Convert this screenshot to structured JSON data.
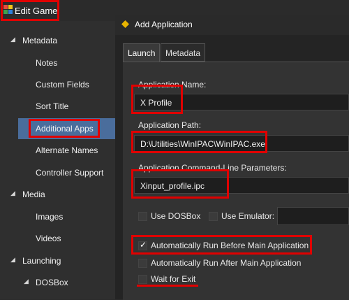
{
  "window": {
    "title": "Edit Game"
  },
  "sidebar": {
    "items": [
      {
        "label": "Metadata",
        "kind": "section"
      },
      {
        "label": "Notes",
        "kind": "child"
      },
      {
        "label": "Custom Fields",
        "kind": "child"
      },
      {
        "label": "Sort Title",
        "kind": "child"
      },
      {
        "label": "Additional Apps",
        "kind": "child",
        "selected": true
      },
      {
        "label": "Alternate Names",
        "kind": "child"
      },
      {
        "label": "Controller Support",
        "kind": "child"
      },
      {
        "label": "Media",
        "kind": "section"
      },
      {
        "label": "Images",
        "kind": "child"
      },
      {
        "label": "Videos",
        "kind": "child"
      },
      {
        "label": "Launching",
        "kind": "section"
      },
      {
        "label": "DOSBox",
        "kind": "subsection"
      }
    ],
    "expand_glyph": "◢",
    "selected_color": "#4a6d9c"
  },
  "dialog": {
    "title": "Add Application",
    "tabs": [
      {
        "label": "Launch",
        "active": true
      },
      {
        "label": "Metadata",
        "active": false
      }
    ],
    "app_name": {
      "label": "Application Name:",
      "value": "X Profile"
    },
    "app_path": {
      "label": "Application Path:",
      "value": "D:\\Utilities\\WinIPAC\\WinIPAC.exe"
    },
    "cmd_params": {
      "label": "Application Command-Line Parameters:",
      "value": "Xinput_profile.ipc"
    },
    "use_dosbox": {
      "label": "Use DOSBox",
      "checked": false
    },
    "use_emulator": {
      "label": "Use Emulator:",
      "checked": false,
      "value": ""
    },
    "auto_before": {
      "label": "Automatically Run Before Main Application",
      "checked": true
    },
    "auto_after": {
      "label": "Automatically Run After Main Application",
      "checked": false
    },
    "wait_exit": {
      "label": "Wait for Exit",
      "checked": false
    },
    "check_glyph": "✓"
  },
  "colors": {
    "annotation": "#e00000",
    "accent_icon": "#e8b400"
  }
}
